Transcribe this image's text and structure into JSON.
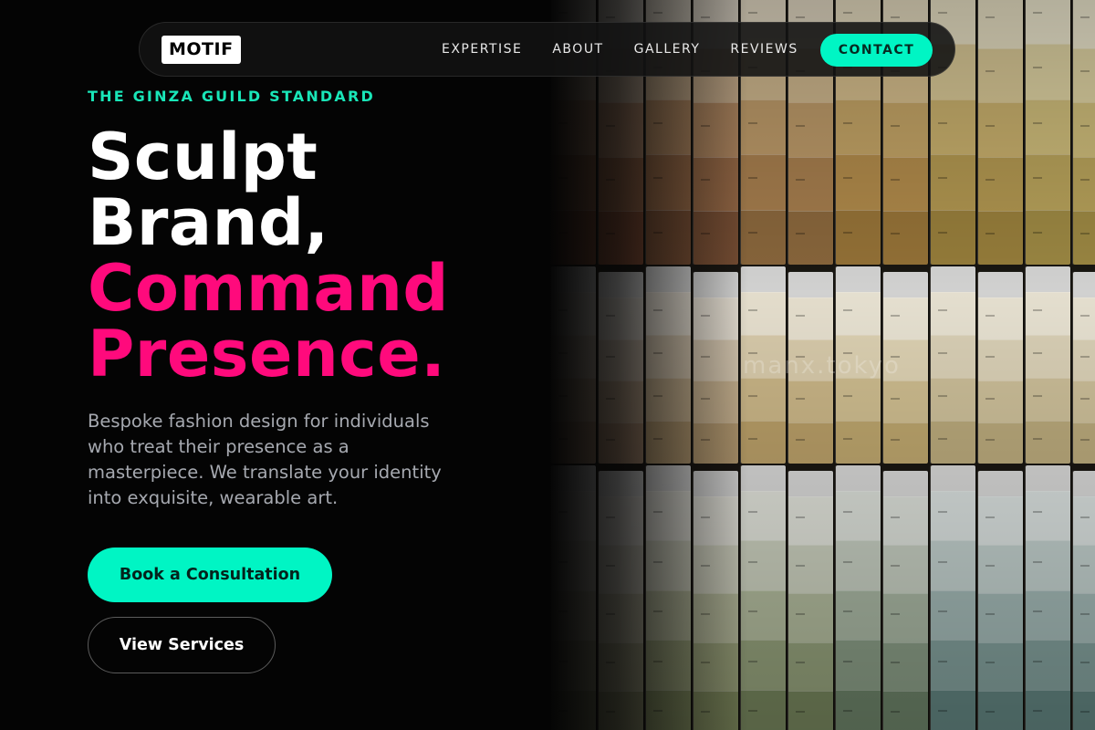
{
  "brand": {
    "logo_text": "MOTIF"
  },
  "nav": {
    "links": [
      "EXPERTISE",
      "ABOUT",
      "GALLERY",
      "REVIEWS"
    ],
    "cta_label": "CONTACT"
  },
  "hero": {
    "eyebrow": "THE GINZA GUILD STANDARD",
    "headline_line1": "Sculpt",
    "headline_line2": "Brand,",
    "headline_line3": "Command",
    "headline_line4": "Presence.",
    "description": "Bespoke fashion design for individuals who treat their presence as a masterpiece. We translate your identity into exquisite, wearable art.",
    "primary_cta": "Book a Consultation",
    "secondary_cta": "View Services",
    "image_watermark": "manx.tokyo"
  },
  "colors": {
    "accent": "#00f5c4",
    "eyebrow": "#19e6b8",
    "headline_highlight": "#ff0a7c",
    "background": "#040404"
  }
}
